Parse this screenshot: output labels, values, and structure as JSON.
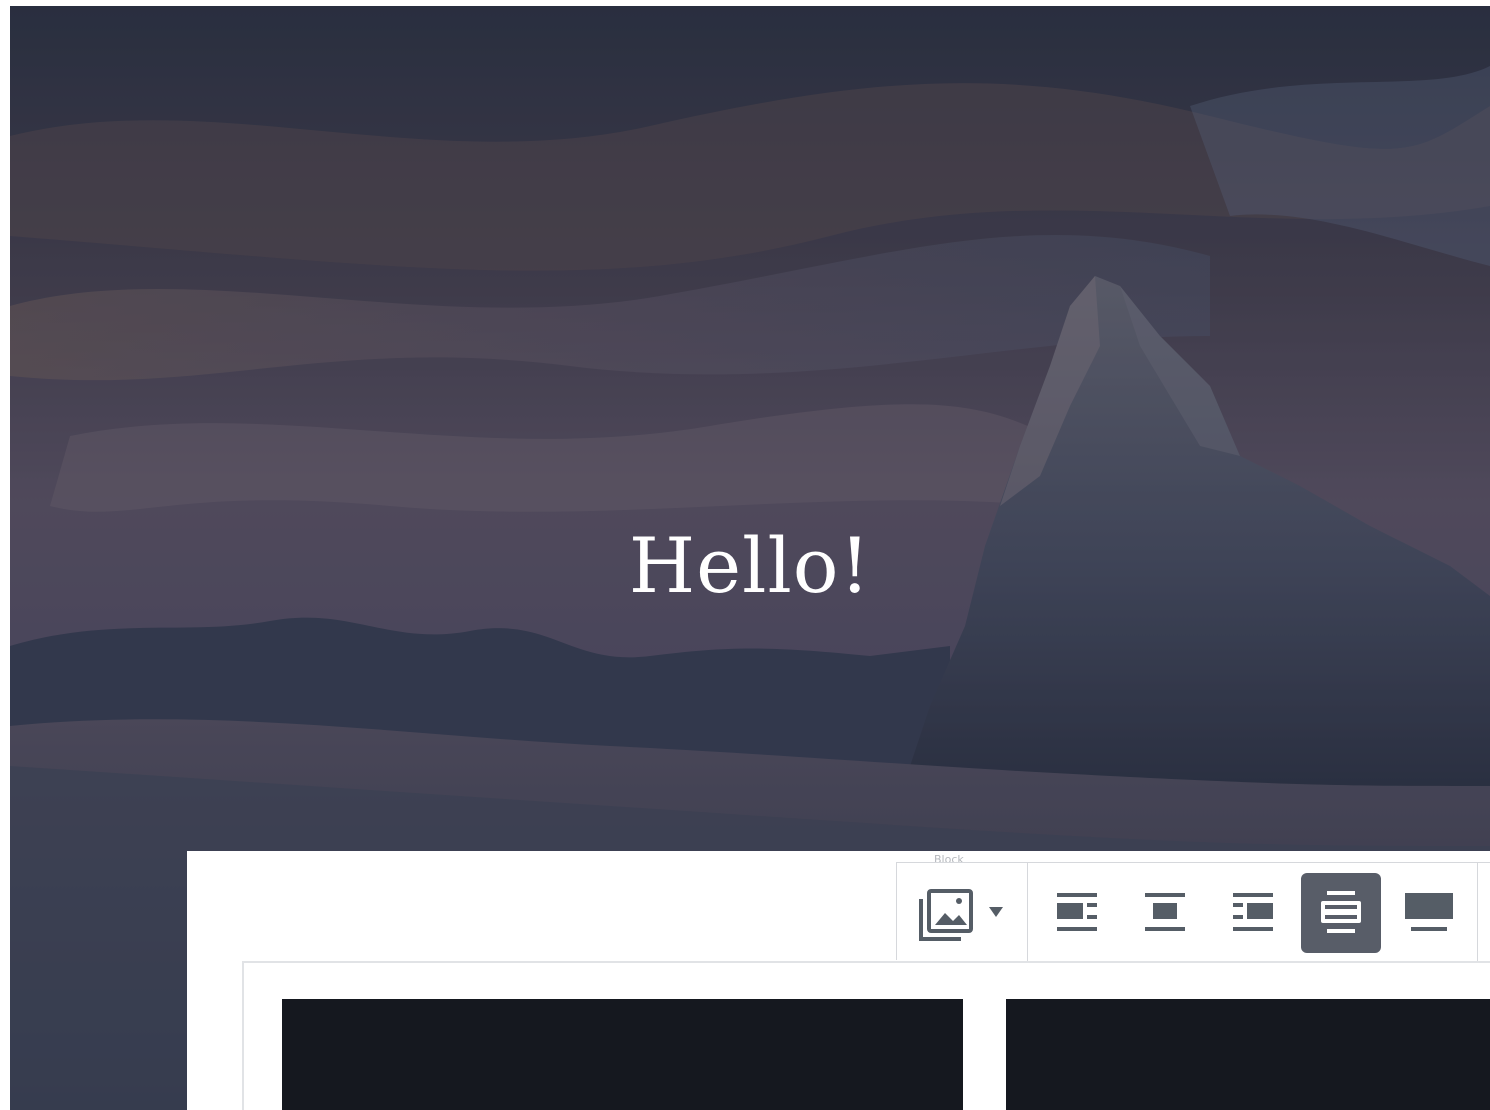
{
  "cover": {
    "title": "Hello!",
    "image_label": "mountain-cover-image"
  },
  "toolbar": {
    "caption": "Block",
    "buttons": [
      {
        "name": "gallery-button",
        "icon": "gallery-icon",
        "has_dropdown": true,
        "dropdown_icon": "caret-down-icon"
      },
      {
        "name": "align-left-button",
        "icon": "align-left-icon",
        "active": false
      },
      {
        "name": "align-center-button",
        "icon": "align-center-icon",
        "active": false
      },
      {
        "name": "align-right-button",
        "icon": "align-right-icon",
        "active": false
      },
      {
        "name": "align-wide-button",
        "icon": "align-wide-icon",
        "active": true
      },
      {
        "name": "align-full-button",
        "icon": "align-full-icon",
        "active": false
      }
    ]
  },
  "gallery": {
    "items": [
      "gallery-item-1",
      "gallery-item-2"
    ]
  },
  "colors": {
    "overlay": "#2b3140",
    "toolbar_active": "#585d68",
    "icon": "#555d66",
    "gallery_item": "#15181f",
    "border": "#d6d8dc"
  }
}
